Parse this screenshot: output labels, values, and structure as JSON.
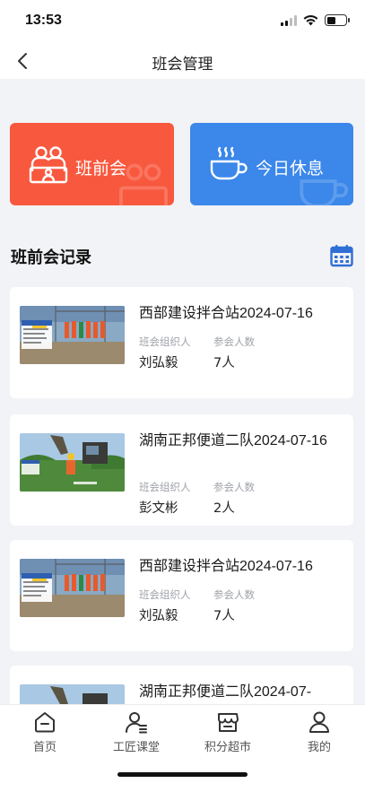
{
  "status_bar": {
    "time": "13:53",
    "battery_level": 0.45
  },
  "nav": {
    "title": "班会管理"
  },
  "actions": [
    {
      "label": "班前会",
      "icon": "people-group-icon",
      "color": "#f8583e"
    },
    {
      "label": "今日休息",
      "icon": "coffee-cup-icon",
      "color": "#3b87ea"
    }
  ],
  "section": {
    "title": "班前会记录",
    "calendar_icon": "calendar-icon",
    "accent": "#2f6fd6"
  },
  "records": [
    {
      "title": "西部建设拌合站2024-07-16",
      "organizer_label": "班会组织人",
      "organizer": "刘弘毅",
      "participants_label": "参会人数",
      "participants": "7人",
      "thumb": "construction-site-photo-group"
    },
    {
      "title": "湖南正邦便道二队2024-07-16",
      "organizer_label": "班会组织人",
      "organizer": "彭文彬",
      "participants_label": "参会人数",
      "participants": "2人",
      "thumb": "excavator-worker-photo"
    },
    {
      "title": "西部建设拌合站2024-07-16",
      "organizer_label": "班会组织人",
      "organizer": "刘弘毅",
      "participants_label": "参会人数",
      "participants": "7人",
      "thumb": "construction-site-photo-group"
    },
    {
      "title": "湖南正邦便道二队2024-07-",
      "thumb": "excavator-worker-photo"
    }
  ],
  "tabs": [
    {
      "label": "首页",
      "icon": "home-icon"
    },
    {
      "label": "工匠课堂",
      "icon": "classroom-icon"
    },
    {
      "label": "积分超市",
      "icon": "store-icon"
    },
    {
      "label": "我的",
      "icon": "user-icon"
    }
  ]
}
